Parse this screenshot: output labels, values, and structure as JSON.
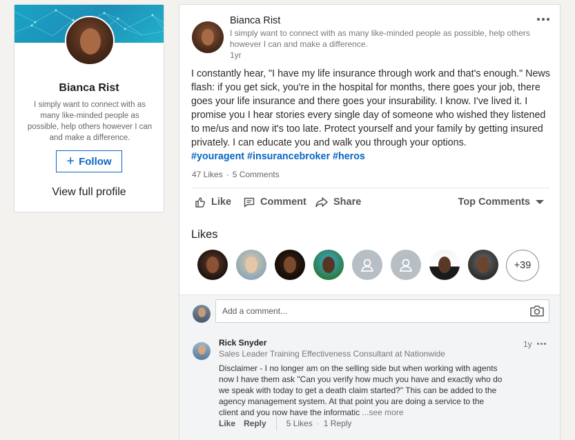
{
  "profile": {
    "name": "Bianca Rist",
    "headline": "I simply want to connect with as many like-minded people as possible, help others however I can and make a difference.",
    "follow_label": "Follow",
    "view_profile_label": "View full profile"
  },
  "post": {
    "author": "Bianca Rist",
    "headline": "I simply want to connect with as many like-minded people as possible, help others however I can and make a difference.",
    "time": "1yr",
    "body": "I constantly hear, \"I have my life insurance through work and that's enough.\" News flash: if you get sick, you're in the hospital for months, there goes your job, there goes your life insurance and there goes your insurability. I know. I've lived it. I promise you I hear stories every single day of someone who wished they listened to me/us and now it's too late. Protect yourself and your family by getting insured privately. I can educate you and walk you through your options.",
    "hashtags": "#youragent #insurancebroker #heros",
    "likes_count": "47 Likes",
    "comments_count": "5 Comments"
  },
  "actions": {
    "like": "Like",
    "comment": "Comment",
    "share": "Share",
    "sort": "Top Comments"
  },
  "likes": {
    "title": "Likes",
    "more": "+39"
  },
  "comment_box": {
    "placeholder": "Add a comment..."
  },
  "comment": {
    "author": "Rick Snyder",
    "headline": "Sales Leader Training Effectiveness Consultant at Nationwide",
    "time": "1y",
    "text": "Disclaimer - I no longer am on the selling side but when working with agents now I have them ask \"Can you verify how much you have and exactly who do we speak with today to get a death claim started?\"  This can be added to the agency management system.  At that point you are doing a service to the client and you now have the informatic",
    "see_more": "...see more",
    "like_label": "Like",
    "reply_label": "Reply",
    "likes_count": "5 Likes",
    "replies_count": "1 Reply"
  },
  "colors": {
    "accent": "#0a66c2",
    "banner": "#1aa3c4"
  }
}
